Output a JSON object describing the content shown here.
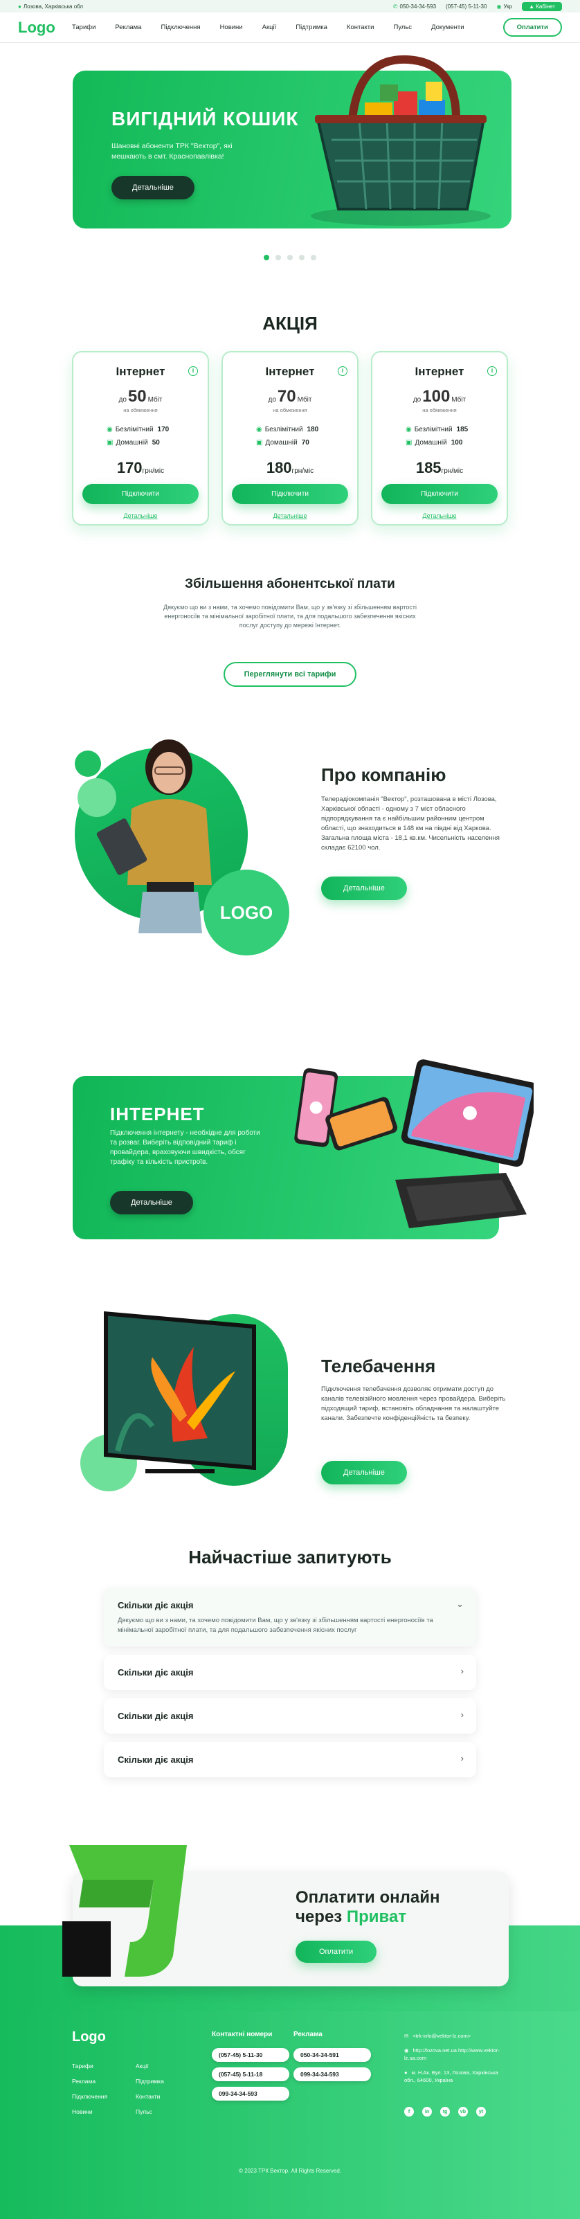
{
  "topbar": {
    "location": "Лозова, Харківська обл",
    "phone1": "050-34-34-593",
    "phone2": "(057-45) 5-11-30",
    "language": "Укр",
    "cabinet": "Кабінет"
  },
  "header": {
    "logo": "Logo",
    "nav": [
      "Тарифи",
      "Реклама",
      "Підключення",
      "Новини",
      "Акції",
      "Підтримка",
      "Контакти",
      "Пульс",
      "Документи"
    ],
    "payment_btn": "Оплатити"
  },
  "hero": {
    "title": "ВИГІДНИЙ КОШИК",
    "text": "Шановні абоненти ТРК \"Вектор\", які мешкають в смт. Краснопавлівка!",
    "button": "Детальніше",
    "slides": 5,
    "active_slide": 1
  },
  "akcia": {
    "title": "АКЦІЯ",
    "tariffs": [
      {
        "name": "Інтернет",
        "prefix": "до",
        "speed": "50",
        "unit": "Мбіт",
        "note": "на обмеження",
        "ch1_label": "Безлімітний",
        "ch1_val": "170",
        "ch2_label": "Домашній",
        "ch2_val": "50",
        "price": "170",
        "price_unit": "грн/міс",
        "button": "Підключити",
        "details": "Детальніше"
      },
      {
        "name": "Інтернет",
        "prefix": "до",
        "speed": "70",
        "unit": "Мбіт",
        "note": "на обмеження",
        "ch1_label": "Безлімітний",
        "ch1_val": "180",
        "ch2_label": "Домашній",
        "ch2_val": "70",
        "price": "180",
        "price_unit": "грн/міс",
        "button": "Підключити",
        "details": "Детальніше"
      },
      {
        "name": "Інтернет",
        "prefix": "до",
        "speed": "100",
        "unit": "Мбіт",
        "note": "на обмеження",
        "ch1_label": "Безлімітний",
        "ch1_val": "185",
        "ch2_label": "Домашній",
        "ch2_val": "100",
        "price": "185",
        "price_unit": "грн/міс",
        "button": "Підключити",
        "details": "Детальніше"
      }
    ]
  },
  "increase": {
    "title": "Збільшення абонентської плати",
    "text": "Дякуємо що ви з нами, та хочемо повідомити Вам, що у зв'язку зі збільшенням вартості енергоносіїв та мінімальної заробітної плати, та для подальшого забезпечення якісних послуг доступу до мережі Інтернет.",
    "button": "Переглянути всі тарифи"
  },
  "about": {
    "title": "Про компанію",
    "text": "Телерадіокомпанія \"Вектор\", розташована в місті Лозова, Харківської області - одному з 7 міст обласного підпорядкування та є найбільшим районним центром області, що знаходиться в 148 км на півдні від Харкова. Загальна площа міста - 18,1 кв.км. Чисельність населення складає 62100 чол.",
    "button": "Детальніше",
    "logo_circle": "LOGO"
  },
  "internet": {
    "title": "ІНТЕРНЕТ",
    "text": "Підключення інтернету - необхідне для роботи та розваг. Виберіть відповідний тариф і провайдера, враховуючи швидкість, обсяг трафіку та кількість пристроїв.",
    "button": "Детальніше"
  },
  "tv": {
    "title": "Телебачення",
    "text": "Підключення телебачення дозволяє отримати доступ до каналів телевізійного мовлення через провайдера. Виберіть підходящий тариф, встановіть обладнання та налаштуйте канали. Забезпечте конфіденційність та безпеку.",
    "button": "Детальніше"
  },
  "faq": {
    "title": "Найчастіше запитують",
    "items": [
      {
        "q": "Скільки діє акція",
        "a": "Дякуємо що ви з нами, та хочемо повідомити Вам, що у зв'язку зі збільшенням вартості енергоносіїв та мінімальної заробітної плати, та для подальшого забезпечення якісних послуг"
      },
      {
        "q": "Скільки діє акція"
      },
      {
        "q": "Скільки діє акція"
      },
      {
        "q": "Скільки діє акція"
      }
    ]
  },
  "payment": {
    "title_line1": "Оплатити онлайн",
    "title_line2_prefix": "через ",
    "title_line2_accent": "Приват",
    "button": "Оплатити"
  },
  "footer": {
    "logo": "Logo",
    "links_col1": [
      "Тарифи",
      "Реклама",
      "Підключення",
      "Новини"
    ],
    "links_col2": [
      "Акції",
      "Підтримка",
      "Контакти",
      "Пульс"
    ],
    "contacts_title": "Контактні номери",
    "contacts": [
      "(057-45) 5-11-30",
      "(057-45) 5-11-18",
      "099-34-34-593"
    ],
    "ads_title": "Реклама",
    "ads": [
      "050-34-34-591",
      "099-34-34-593"
    ],
    "email": "<trk-info@vektor-lz.com>",
    "site": "http://lozova.net.ua http://www.vektor-lz.ua.com",
    "address": "м. Н.Ак. Вул. 13, Лозова, Харківська обл., 64600, Україна",
    "social": [
      "f",
      "in",
      "tg",
      "vb",
      "yt"
    ],
    "copyright": "© 2023 ТРК Вектор. All Rights Reserved."
  },
  "colors": {
    "accent": "#1fbf62",
    "dark": "#17372a"
  }
}
